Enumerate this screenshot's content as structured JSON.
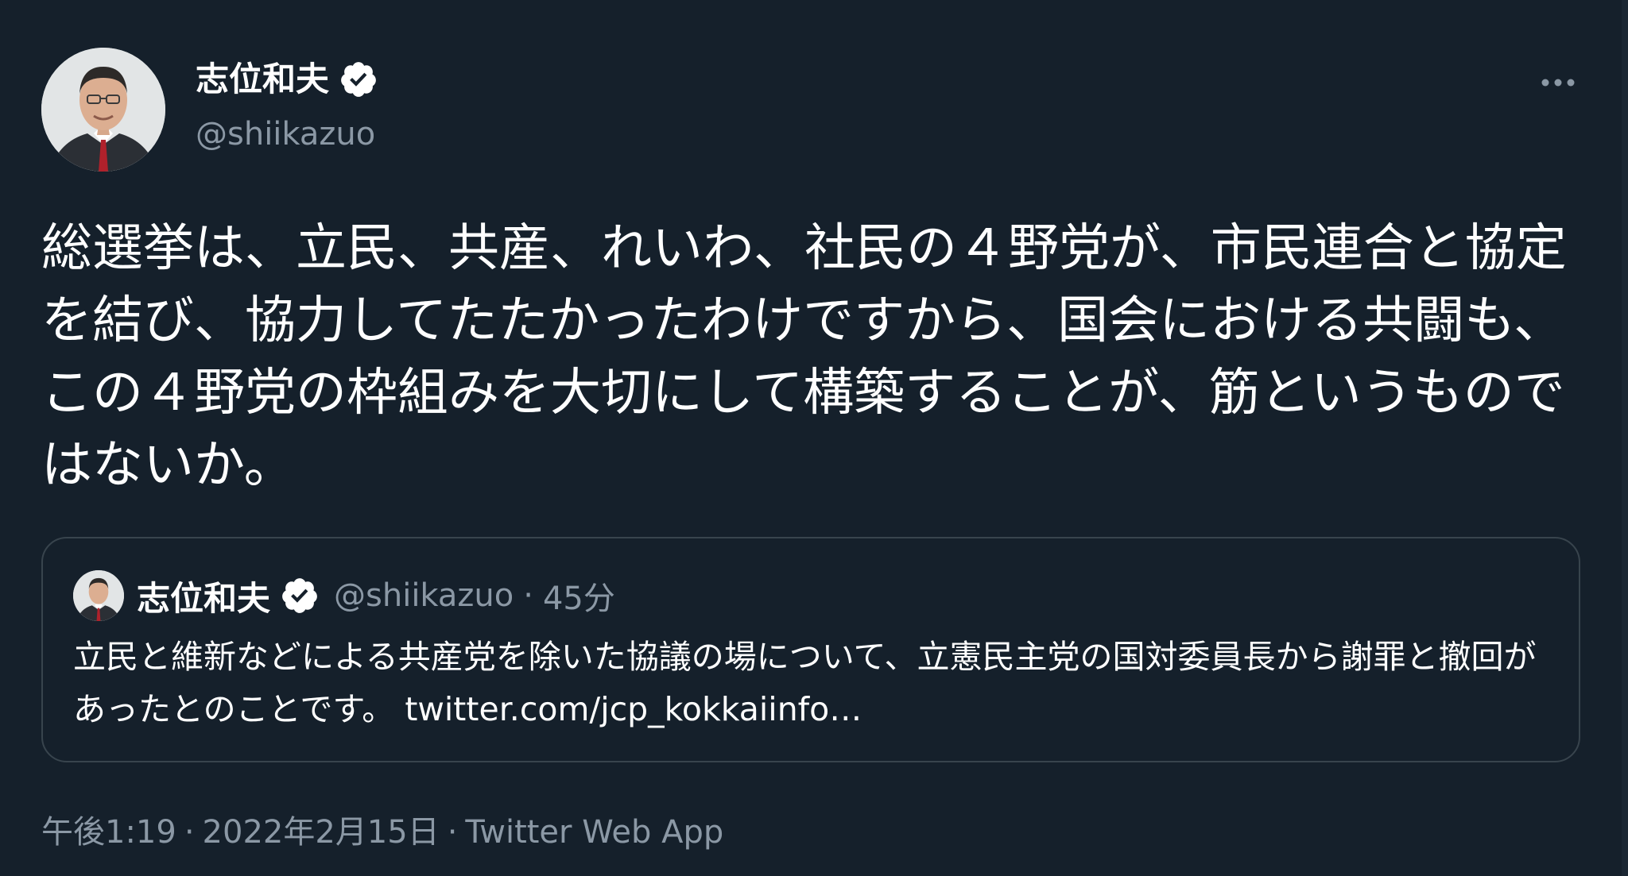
{
  "author": {
    "name": "志位和夫",
    "handle": "@shiikazuo"
  },
  "icons": {
    "more": "more-horizontal-icon",
    "verified": "verified-badge-icon",
    "avatar": "profile-avatar"
  },
  "tweet": {
    "text": "総選挙は、立民、共産、れいわ、社民の４野党が、市民連合と協定を結び、協力してたたかったわけですから、国会における共闘も、この４野党の枠組みを大切にして構築することが、筋というものではないか。"
  },
  "quoted_tweet": {
    "name": "志位和夫",
    "handle": "@shiikazuo",
    "separator": "·",
    "time": "45分",
    "text": "立民と維新などによる共産党を除いた協議の場について、立憲民主党の国対委員長から謝罪と撤回があったとのことです。",
    "link": "twitter.com/jcp_kokkaiinfo…"
  },
  "meta": {
    "time": "午後1:19",
    "separator": "·",
    "date": "2022年2月15日",
    "source": "Twitter Web App"
  },
  "colors": {
    "background": "#15202b",
    "text": "#ffffff",
    "secondary_text": "#8b98a5",
    "border": "#38444d",
    "verified_badge": "#ffffff"
  }
}
